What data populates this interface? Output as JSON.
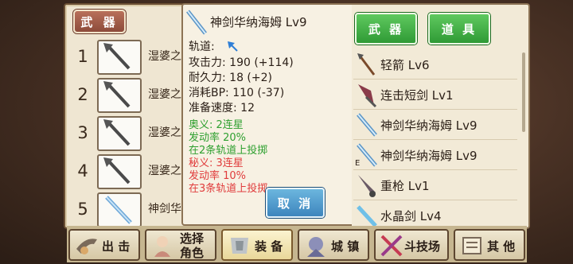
{
  "left_tab": "武 器",
  "slots": [
    {
      "num": "1",
      "name": "湿婆之"
    },
    {
      "num": "2",
      "name": "湿婆之"
    },
    {
      "num": "3",
      "name": "湿婆之"
    },
    {
      "num": "4",
      "name": "湿婆之"
    },
    {
      "num": "5",
      "name": "神剑华"
    }
  ],
  "detail": {
    "title": "神剑华纳海姆 Lv9",
    "track_label": "轨道:",
    "attack": "攻击力: 190 (+114)",
    "durability": "耐久力: 18 (+2)",
    "bp_cost": "消耗BP: 110 (-37)",
    "ready_speed": "准备速度: 12",
    "ougi_name": "奥义: 2连星",
    "ougi_rate": "发动率 20%",
    "ougi_desc": "在2条轨道上投掷",
    "higi_name": "秘义: 3连星",
    "higi_rate": "发动率 10%",
    "higi_desc": "在3条轨道上投掷",
    "cancel_label": "取 消"
  },
  "right_tabs": {
    "weapon": "武 器",
    "items": "道 具"
  },
  "item_list": [
    {
      "label": "轻箭 Lv6",
      "icon": "arrow-icon",
      "mark": ""
    },
    {
      "label": "连击短剑 Lv1",
      "icon": "dagger-icon",
      "mark": ""
    },
    {
      "label": "神剑华纳海姆 Lv9",
      "icon": "sword-icon",
      "mark": ""
    },
    {
      "label": "神剑华纳海姆 Lv9",
      "icon": "sword-icon",
      "mark": "E"
    },
    {
      "label": "重枪 Lv1",
      "icon": "lance-icon",
      "mark": ""
    },
    {
      "label": "水晶剑 Lv4",
      "icon": "crystal-sword-icon",
      "mark": ""
    }
  ],
  "menu": [
    {
      "label": "出 击",
      "icon": "sortie-icon"
    },
    {
      "label": "选择\n角色",
      "icon": "character-icon"
    },
    {
      "label": "装 备",
      "icon": "armor-icon"
    },
    {
      "label": "城 镇",
      "icon": "town-icon"
    },
    {
      "label": "斗技场",
      "icon": "arena-icon"
    },
    {
      "label": "其 他",
      "icon": "scroll-icon"
    }
  ],
  "colors": {
    "green_text": "#2fa030",
    "red_text": "#e03c3c",
    "active_tab": "#2f9a35",
    "cancel": "#3d85bd"
  }
}
